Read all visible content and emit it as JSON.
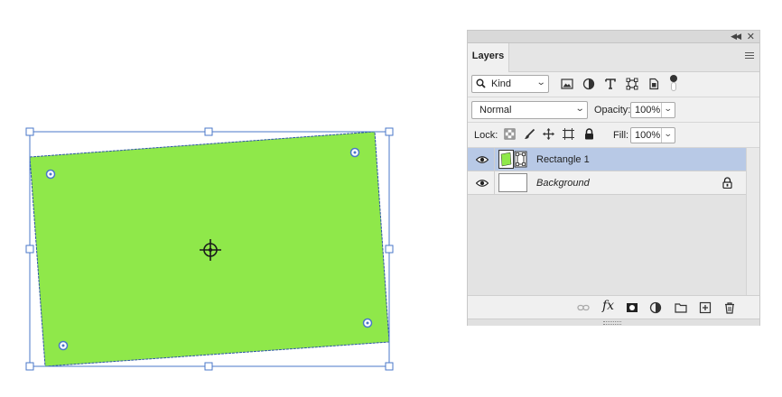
{
  "canvas": {
    "shape_color": "#8fe84a",
    "selection_color": "#4a77c9"
  },
  "panel": {
    "collapse_icon": "double-chevron-left-icon",
    "close_icon": "close-icon",
    "tab_label": "Layers",
    "menu_icon": "hamburger-menu-icon",
    "kind": {
      "value": "Kind",
      "icon": "search-icon"
    },
    "filter_icons": [
      "pixel-layer-filter-icon",
      "adjustment-layer-filter-icon",
      "type-layer-filter-icon",
      "shape-layer-filter-icon",
      "smart-object-filter-icon"
    ],
    "blend_mode": "Normal",
    "opacity_label": "Opacity:",
    "opacity_value": "100%",
    "lock_label": "Lock:",
    "lock_icons": [
      "lock-transparent-pixels-icon",
      "lock-image-pixels-icon",
      "lock-position-icon",
      "prevent-autonest-icon",
      "lock-all-icon"
    ],
    "fill_label": "Fill:",
    "fill_value": "100%",
    "layers": [
      {
        "name": "Rectangle 1",
        "selected": true,
        "visible": true,
        "type": "shape"
      },
      {
        "name": "Background",
        "selected": false,
        "visible": true,
        "locked": true,
        "type": "background"
      }
    ],
    "bottom_icons": [
      "link-layers-icon",
      "fx-icon",
      "add-mask-icon",
      "new-adjustment-layer-icon",
      "new-group-folder-icon",
      "new-layer-icon",
      "delete-layer-icon"
    ],
    "fx_label": "fx"
  }
}
